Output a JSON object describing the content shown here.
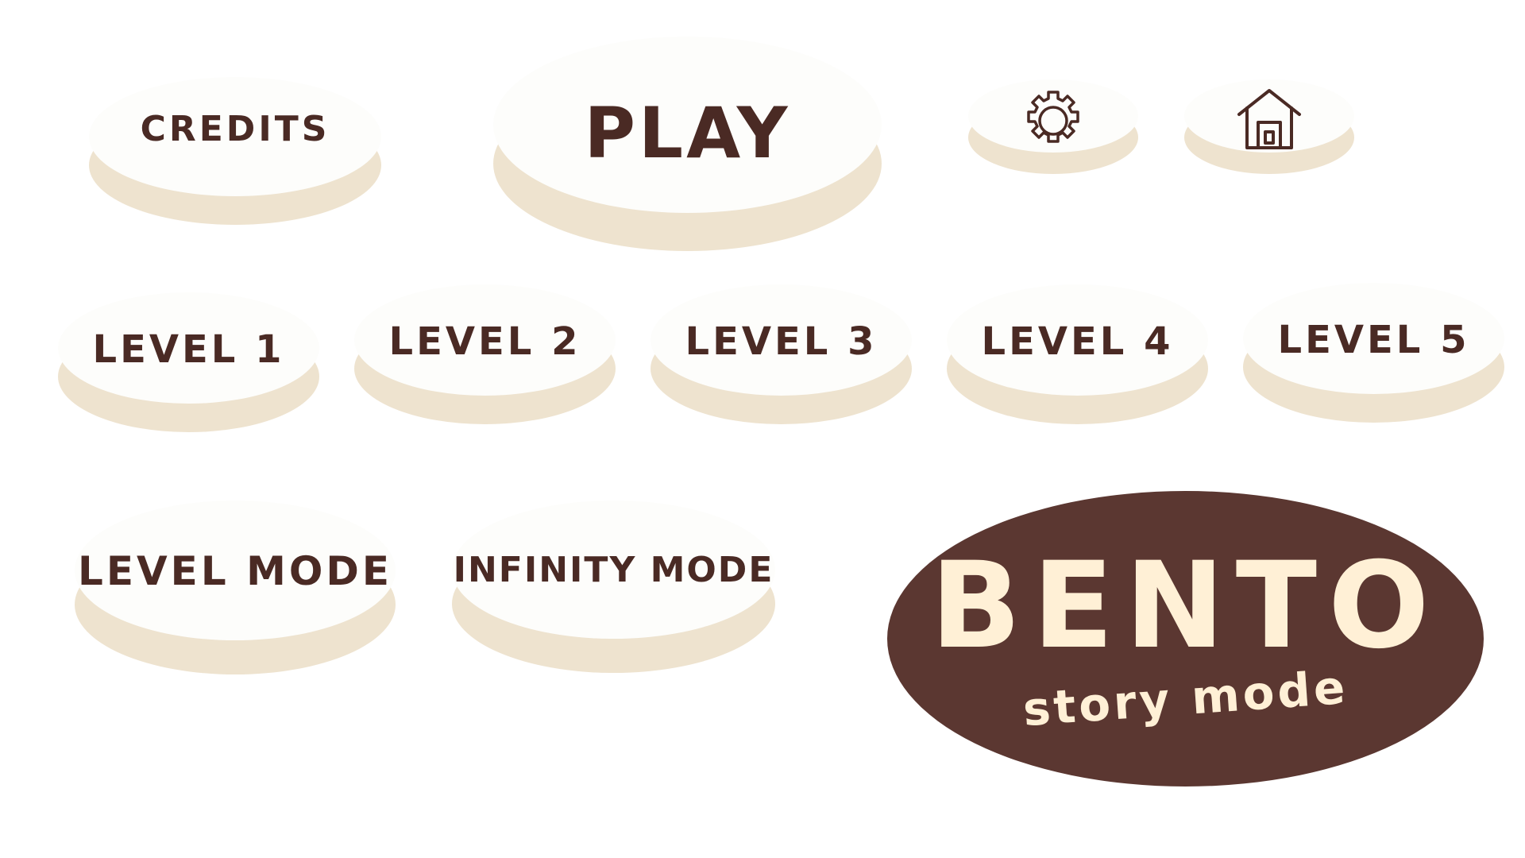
{
  "colors": {
    "background": "#ffffff",
    "button_face": "#fdfdfb",
    "button_base": "#eee3cf",
    "button_text": "#4a2a24",
    "logo_fill": "#5b3731",
    "logo_text": "#fff0d6"
  },
  "menu": {
    "credits_label": "CREDITS",
    "play_label": "PLAY",
    "settings_icon": "gear-icon",
    "home_icon": "house-icon"
  },
  "levels": {
    "level1": "LEVEL 1",
    "level2": "LEVEL 2",
    "level3": "LEVEL 3",
    "level4": "LEVEL 4",
    "level5": "LEVEL 5"
  },
  "modes": {
    "level_mode": "LEVEL MODE",
    "infinity_mode": "INFINITY MODE"
  },
  "logo": {
    "title": "BENTO",
    "subtitle": "story mode"
  }
}
